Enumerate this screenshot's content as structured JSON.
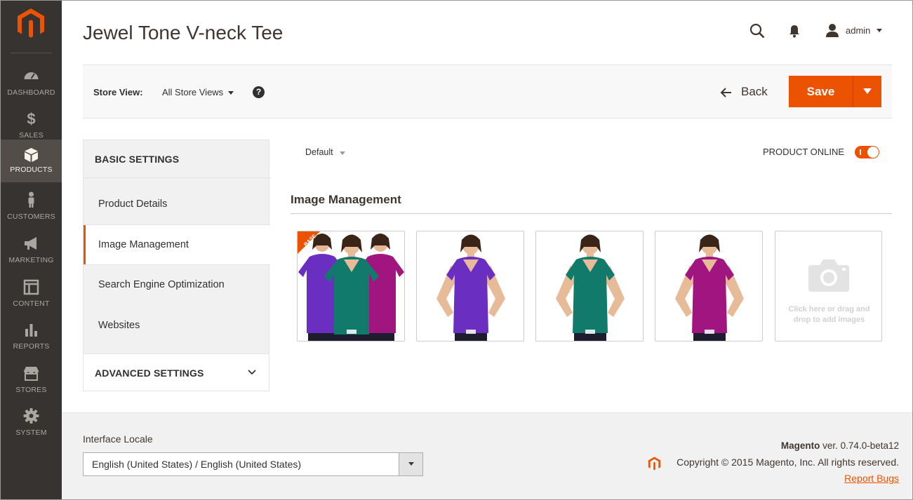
{
  "app": {
    "page_title": "Jewel Tone V-neck Tee",
    "brand_color": "#eb5202"
  },
  "sidebar": {
    "items": [
      {
        "label": "DASHBOARD",
        "icon": "dashboard-icon"
      },
      {
        "label": "SALES",
        "icon": "dollar-icon"
      },
      {
        "label": "PRODUCTS",
        "icon": "cube-icon",
        "active": true
      },
      {
        "label": "CUSTOMERS",
        "icon": "person-icon"
      },
      {
        "label": "MARKETING",
        "icon": "megaphone-icon"
      },
      {
        "label": "CONTENT",
        "icon": "layout-icon"
      },
      {
        "label": "REPORTS",
        "icon": "bar-chart-icon"
      },
      {
        "label": "STORES",
        "icon": "storefront-icon"
      },
      {
        "label": "SYSTEM",
        "icon": "gear-icon"
      }
    ]
  },
  "header": {
    "user": "admin"
  },
  "toolbar": {
    "store_view_label": "Store View:",
    "store_view_value": "All Store Views",
    "help": "?",
    "back_label": "Back",
    "save_label": "Save"
  },
  "tabs": {
    "basic_heading": "BASIC SETTINGS",
    "items": [
      {
        "label": "Product Details"
      },
      {
        "label": "Image Management",
        "active": true
      },
      {
        "label": "Search Engine Optimization"
      },
      {
        "label": "Websites"
      }
    ],
    "advanced_heading": "ADVANCED SETTINGS"
  },
  "main": {
    "attribute_set": "Default",
    "product_online_label": "PRODUCT ONLINE",
    "product_online": true,
    "section_title": "Image Management",
    "base_badge": "BASE",
    "images": [
      {
        "role": "base",
        "colors": [
          "#6a2fc0",
          "#127a6a",
          "#a0157f"
        ]
      },
      {
        "colors": [
          "#6a2fc0"
        ]
      },
      {
        "colors": [
          "#127a6a"
        ]
      },
      {
        "colors": [
          "#a0157f"
        ]
      }
    ],
    "add_image_text": "Click here or drag and drop to add images"
  },
  "footer": {
    "locale_label": "Interface Locale",
    "locale_value": "English (United States) / English (United States)",
    "brand": "Magento",
    "version": " ver. 0.74.0-beta12",
    "copyright": "Copyright © 2015 Magento, Inc. All rights reserved.",
    "report_bugs": "Report Bugs"
  }
}
